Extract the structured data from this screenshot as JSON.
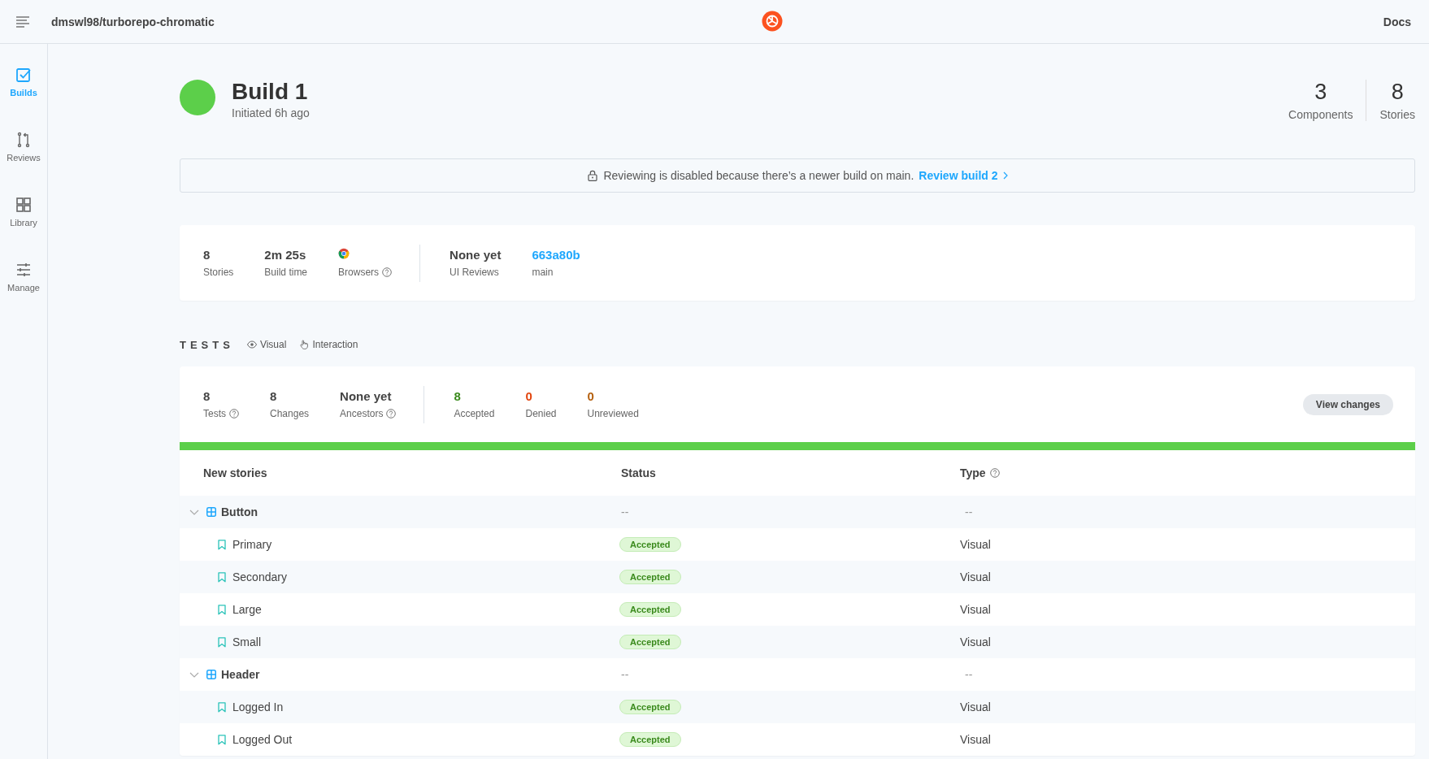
{
  "topbar": {
    "repo": "dmswl98/turborepo-chromatic",
    "docs_link": "Docs"
  },
  "sidebar": {
    "items": [
      {
        "label": "Builds",
        "kind": "builds",
        "selected": true
      },
      {
        "label": "Reviews",
        "kind": "reviews",
        "selected": false
      },
      {
        "label": "Library",
        "kind": "library",
        "selected": false
      },
      {
        "label": "Manage",
        "kind": "manage",
        "selected": false
      }
    ]
  },
  "build": {
    "title": "Build 1",
    "subtitle": "Initiated 6h ago",
    "totals": [
      {
        "value": "3",
        "label": "Components"
      },
      {
        "value": "8",
        "label": "Stories"
      }
    ]
  },
  "banner": {
    "message": "Reviewing is disabled because there’s a newer build on main.",
    "link": "Review build 2"
  },
  "build_stats": {
    "groups": [
      {
        "items": [
          {
            "kind": "text",
            "value": "8",
            "label": "Stories",
            "help": false
          },
          {
            "kind": "text",
            "value": "2m 25s",
            "label": "Build time",
            "help": false
          },
          {
            "kind": "browser",
            "label": "Browsers",
            "help": true
          }
        ]
      },
      {
        "items": [
          {
            "kind": "text",
            "value": "None yet",
            "label": "UI Reviews",
            "help": false
          },
          {
            "kind": "link",
            "value": "663a80b",
            "label": "main",
            "help": false
          }
        ]
      }
    ]
  },
  "tests": {
    "heading": "TESTS",
    "filters": [
      {
        "label": "Visual",
        "kind": "visual"
      },
      {
        "label": "Interaction",
        "kind": "interaction"
      }
    ],
    "summary": {
      "groups": [
        {
          "items": [
            {
              "kind": "text",
              "value": "8",
              "label": "Tests",
              "help": true
            },
            {
              "kind": "text",
              "value": "8",
              "label": "Changes",
              "help": false
            },
            {
              "kind": "text",
              "value": "None yet",
              "label": "Ancestors",
              "help": true
            }
          ]
        },
        {
          "items": [
            {
              "kind": "text",
              "value": "8",
              "label": "Accepted",
              "help": false,
              "color": "#3a8a1c"
            },
            {
              "kind": "text",
              "value": "0",
              "label": "Denied",
              "help": false,
              "color": "#e2450e"
            },
            {
              "kind": "text",
              "value": "0",
              "label": "Unreviewed",
              "help": false,
              "color": "#b5600f"
            }
          ]
        }
      ]
    },
    "view_changes_button": "View changes",
    "progress": {
      "level": 1
    },
    "table": {
      "columns": [
        {
          "label": "New stories",
          "help": false
        },
        {
          "label": "Status",
          "help": false
        },
        {
          "label": "Type",
          "help": true
        }
      ],
      "rows": [
        {
          "name": "Button",
          "kind": "component",
          "expanded": true,
          "status": "--",
          "type": "--",
          "children": [
            {
              "name": "Primary",
              "kind": "story",
              "status": "Accepted",
              "type": "Visual"
            },
            {
              "name": "Secondary",
              "kind": "story",
              "status": "Accepted",
              "type": "Visual"
            },
            {
              "name": "Large",
              "kind": "story",
              "status": "Accepted",
              "type": "Visual"
            },
            {
              "name": "Small",
              "kind": "story",
              "status": "Accepted",
              "type": "Visual"
            }
          ]
        },
        {
          "name": "Header",
          "kind": "component",
          "expanded": true,
          "status": "--",
          "type": "--",
          "children": [
            {
              "name": "Logged In",
              "kind": "story",
              "status": "Accepted",
              "type": "Visual"
            },
            {
              "name": "Logged Out",
              "kind": "story",
              "status": "Accepted",
              "type": "Visual"
            }
          ]
        }
      ]
    }
  }
}
